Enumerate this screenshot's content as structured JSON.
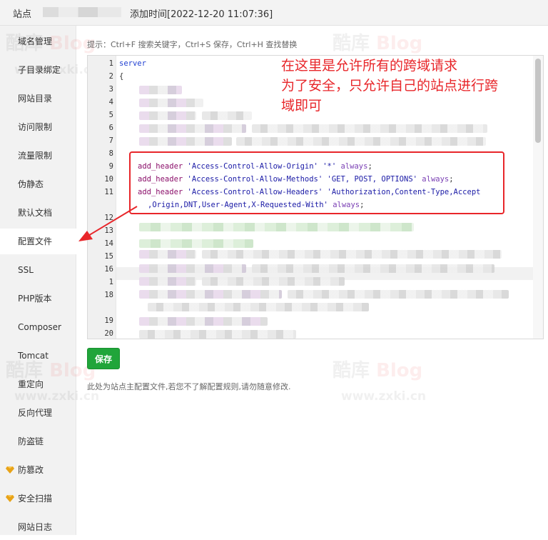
{
  "titlebar": {
    "site_label": "站点",
    "added_time": "添加时间[2022-12-20 11:07:36]"
  },
  "sidebar": {
    "items": [
      {
        "label": "域名管理"
      },
      {
        "label": "子目录绑定"
      },
      {
        "label": "网站目录"
      },
      {
        "label": "访问限制"
      },
      {
        "label": "流量限制"
      },
      {
        "label": "伪静态"
      },
      {
        "label": "默认文档"
      },
      {
        "label": "配置文件"
      },
      {
        "label": "SSL"
      },
      {
        "label": "PHP版本"
      },
      {
        "label": "Composer"
      },
      {
        "label": "Tomcat"
      },
      {
        "label": "重定向"
      },
      {
        "label": "反向代理"
      },
      {
        "label": "防盗链"
      },
      {
        "label": "防篡改"
      },
      {
        "label": "安全扫描"
      },
      {
        "label": "网站日志"
      }
    ],
    "active_index": 7,
    "gem_items": [
      15,
      16
    ],
    "gem_icon": "gem-icon",
    "gem_color": "#e8a317"
  },
  "hint": "提示：Ctrl+F 搜索关键字，Ctrl+S 保存，Ctrl+H 查找替换",
  "editor": {
    "line_numbers": [
      "1",
      "2",
      "3",
      "4",
      "5",
      "6",
      "7",
      "8",
      "9",
      "10",
      "11",
      "",
      "12",
      "13",
      "14",
      "15",
      "16",
      "1",
      "18",
      "",
      "19",
      "20"
    ],
    "line1": "server",
    "line2": "{",
    "header_directive": "add_header",
    "always": "always",
    "line9_name": "'Access-Control-Allow-Origin'",
    "line9_value": "'*'",
    "line10_name": "'Access-Control-Allow-Methods'",
    "line10_value": "'GET, POST, OPTIONS'",
    "line11_name": "'Access-Control-Allow-Headers'",
    "line11_value": "'Authorization,Content-Type,Accept",
    "line11_cont": ",Origin,DNT,User-Agent,X-Requested-With'",
    "line11_end": ";",
    "semicolon": ";"
  },
  "annotation": {
    "line1": "在这里是允许所有的跨域请求",
    "line2": "为了安全，只允许自己的站点进行跨",
    "line3": "域即可",
    "color": "#e8262a"
  },
  "save_label": "保存",
  "note": "此处为站点主配置文件,若您不了解配置规则,请勿随意修改.",
  "watermark": {
    "cn": "酷库",
    "blog": "Blog",
    "url": "www.zxki.cn"
  },
  "colors": {
    "accent_green": "#20a53a",
    "annotation_red": "#e8262a"
  }
}
